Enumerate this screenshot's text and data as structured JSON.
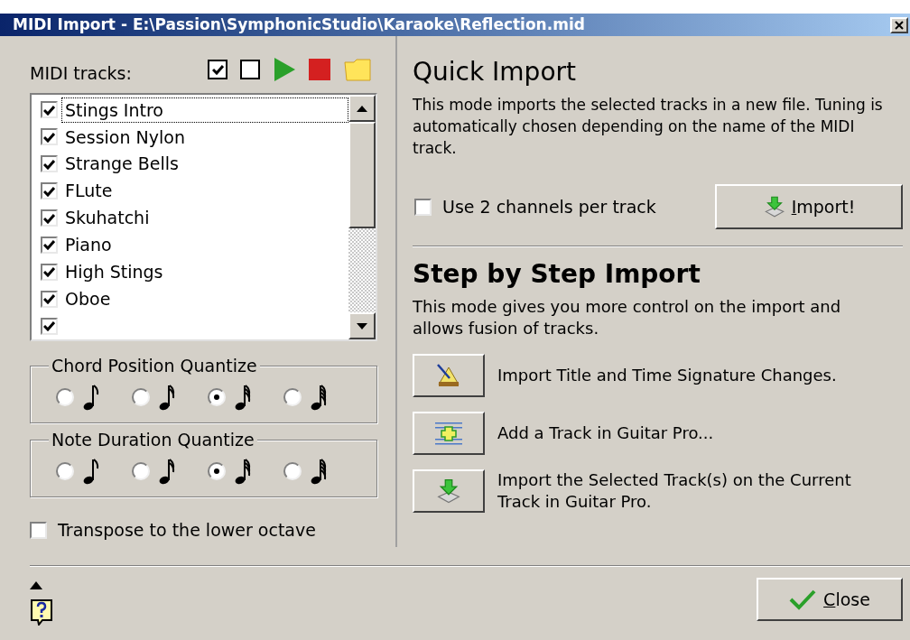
{
  "window": {
    "title": "MIDI Import - E:\\Passion\\SymphonicStudio\\Karaoke\\Reflection.mid"
  },
  "tracks": {
    "label": "MIDI tracks:",
    "items": [
      {
        "name": "Stings Intro",
        "checked": true,
        "selected": true
      },
      {
        "name": "Session Nylon",
        "checked": true,
        "selected": false
      },
      {
        "name": "Strange Bells",
        "checked": true,
        "selected": false
      },
      {
        "name": "FLute",
        "checked": true,
        "selected": false
      },
      {
        "name": "Skuhatchi",
        "checked": true,
        "selected": false
      },
      {
        "name": "Piano",
        "checked": true,
        "selected": false
      },
      {
        "name": "High Stings",
        "checked": true,
        "selected": false
      },
      {
        "name": "Oboe",
        "checked": true,
        "selected": false
      },
      {
        "checked": true,
        "selected": false
      }
    ]
  },
  "chord_position_quantize": {
    "label": "Chord Position Quantize",
    "options": [
      {
        "selected": false
      },
      {
        "selected": false
      },
      {
        "selected": true
      },
      {
        "selected": false
      }
    ]
  },
  "note_duration_quantize": {
    "label": "Note Duration Quantize",
    "options": [
      {
        "selected": false
      },
      {
        "selected": false
      },
      {
        "selected": true
      },
      {
        "selected": false
      }
    ]
  },
  "transpose": {
    "label": "Transpose to the lower octave",
    "checked": false
  },
  "quick_import": {
    "title": "Quick Import",
    "description": "This mode imports the selected tracks in a new file. Tuning is automatically chosen depending on the name of the MIDI track.",
    "option": {
      "label": "Use 2 channels per track",
      "checked": false
    },
    "button": "Import!"
  },
  "step_by_step": {
    "title": "Step by Step Import",
    "description": "This mode gives you more control on the import and allows fusion of tracks.",
    "actions": [
      {
        "kind": "metronome",
        "label": "Import Title and Time Signature Changes."
      },
      {
        "kind": "add_track",
        "label": "Add a Track in Guitar Pro..."
      },
      {
        "kind": "import",
        "label": "Import the Selected Track(s) on the Current Track in Guitar Pro."
      }
    ]
  },
  "close_button": "Close"
}
